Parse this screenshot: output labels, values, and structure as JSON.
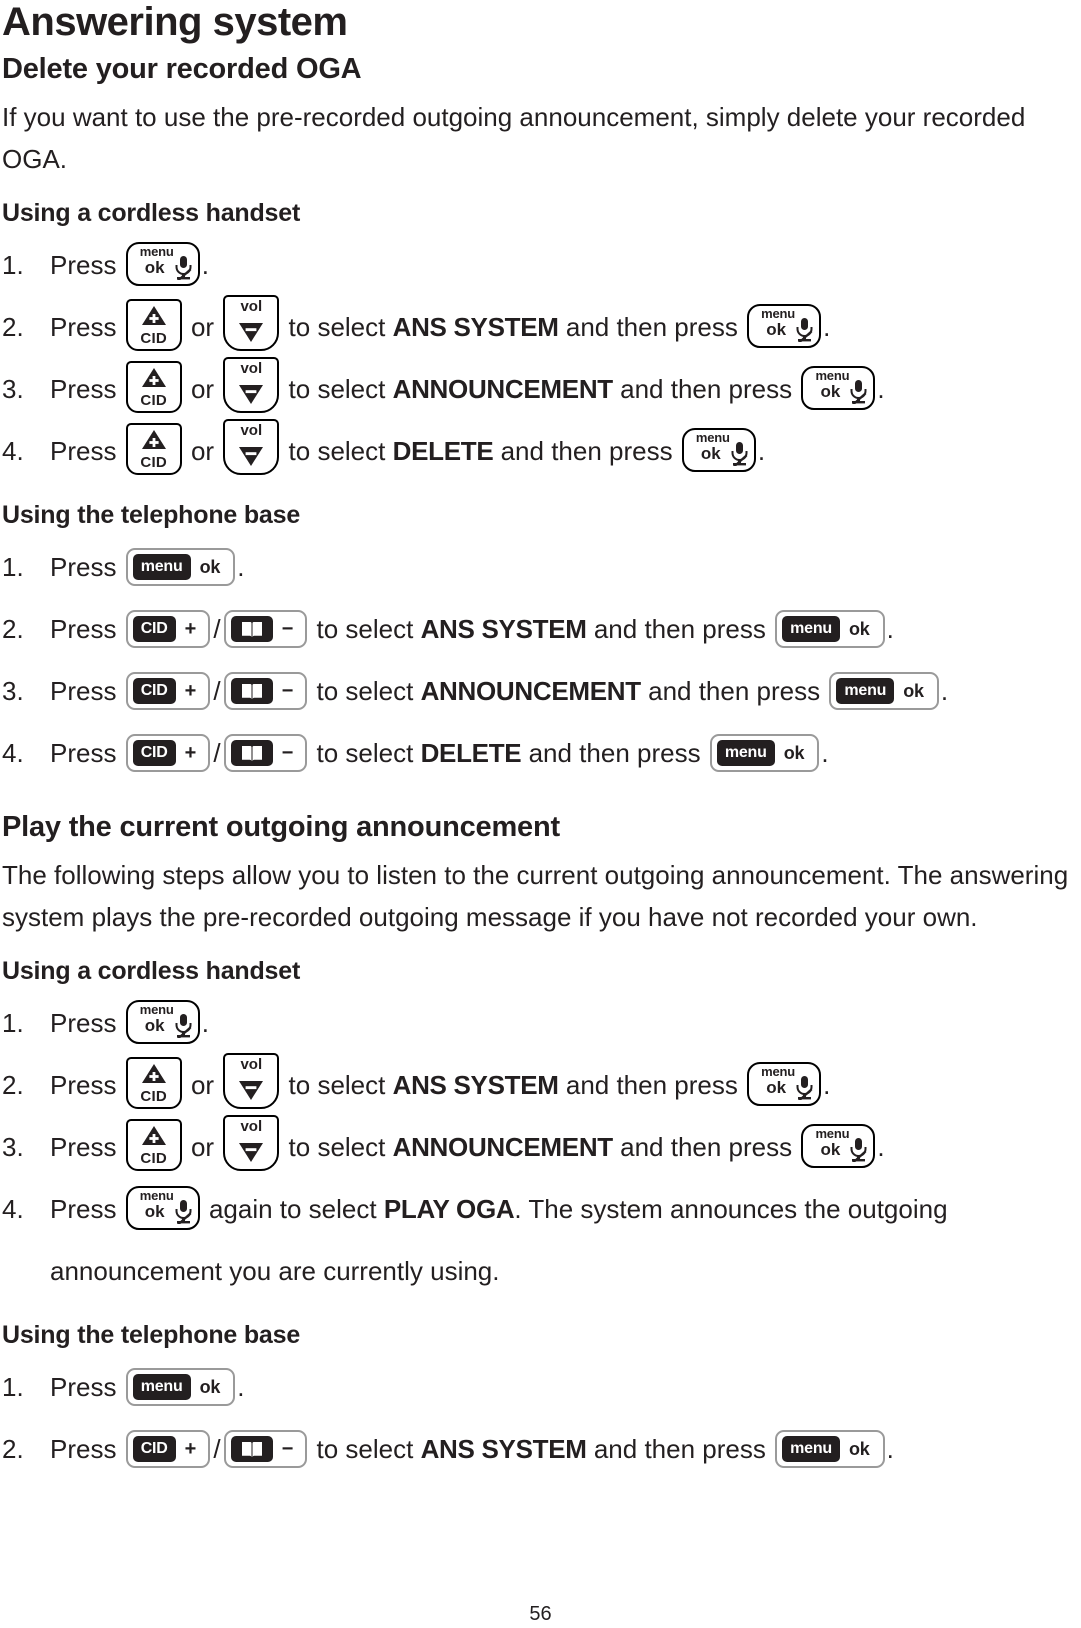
{
  "page": {
    "chapter_title": "Answering system",
    "page_number": "56"
  },
  "sections": [
    {
      "title": "Delete your recorded OGA",
      "intro": "If you want to use the pre-recorded outgoing announcement, simply delete your recorded OGA.",
      "groups": [
        {
          "heading": "Using a cordless handset",
          "steps": [
            {
              "press_label": "Press",
              "period": "."
            },
            {
              "press_label": "Press",
              "or_label": "or",
              "to_select_label": "to select",
              "value": "ANS SYSTEM",
              "then_label": "and then press",
              "period": "."
            },
            {
              "press_label": "Press",
              "or_label": "or",
              "to_select_label": "to select",
              "value": "ANNOUNCEMENT",
              "then_label": "and then press",
              "period": "."
            },
            {
              "press_label": "Press",
              "or_label": "or",
              "to_select_label": "to select",
              "value": "DELETE",
              "then_label": "and then press",
              "period": "."
            }
          ]
        },
        {
          "heading": "Using the telephone base",
          "steps": [
            {
              "press_label": "Press",
              "period": "."
            },
            {
              "press_label": "Press",
              "to_select_label": "to select",
              "value": "ANS SYSTEM",
              "then_label": "and then press",
              "period": "."
            },
            {
              "press_label": "Press",
              "to_select_label": "to select",
              "value": "ANNOUNCEMENT",
              "then_label": "and then press",
              "period": "."
            },
            {
              "press_label": "Press",
              "to_select_label": "to select",
              "value": "DELETE",
              "then_label": "and then press",
              "period": "."
            }
          ]
        }
      ]
    },
    {
      "title": "Play the current outgoing announcement",
      "intro": "The following steps allow you to listen to the current outgoing announcement. The answering system plays the pre-recorded outgoing message if you have not recorded your own.",
      "groups": [
        {
          "heading": "Using a cordless handset",
          "steps": [
            {
              "press_label": "Press",
              "period": "."
            },
            {
              "press_label": "Press",
              "or_label": "or",
              "to_select_label": "to select",
              "value": "ANS SYSTEM",
              "then_label": "and then press",
              "period": "."
            },
            {
              "press_label": "Press",
              "or_label": "or",
              "to_select_label": "to select",
              "value": "ANNOUNCEMENT",
              "then_label": "and then press",
              "period": "."
            },
            {
              "press_label": "Press",
              "again_label": "again to select",
              "value": "PLAY OGA",
              "tail": ". The system announces the outgoing announcement you are currently using."
            }
          ]
        },
        {
          "heading": "Using the telephone base",
          "steps": [
            {
              "press_label": "Press",
              "period": "."
            },
            {
              "press_label": "Press",
              "to_select_label": "to select",
              "value": "ANS SYSTEM",
              "then_label": "and then press",
              "period": "."
            }
          ]
        }
      ]
    }
  ],
  "keys": {
    "handset_menu_ok": {
      "top": "menu",
      "bottom": "ok",
      "icon": "mute-microphone-icon"
    },
    "handset_cid_up": {
      "label": "CID",
      "icon": "triangle-up-plus-icon"
    },
    "handset_vol_down": {
      "label": "vol",
      "icon": "triangle-down-minus-icon"
    },
    "base_menu_ok": {
      "pill": "menu",
      "symbol": "ok"
    },
    "base_cid_plus": {
      "pill": "CID",
      "symbol": "+"
    },
    "base_book_minus": {
      "pill": "directory-book-icon",
      "symbol": "−"
    },
    "separator": "/"
  },
  "colors": {
    "text": "#231f20",
    "key_border_base": "#9a9a9a",
    "pill_fill": "#231f20"
  }
}
